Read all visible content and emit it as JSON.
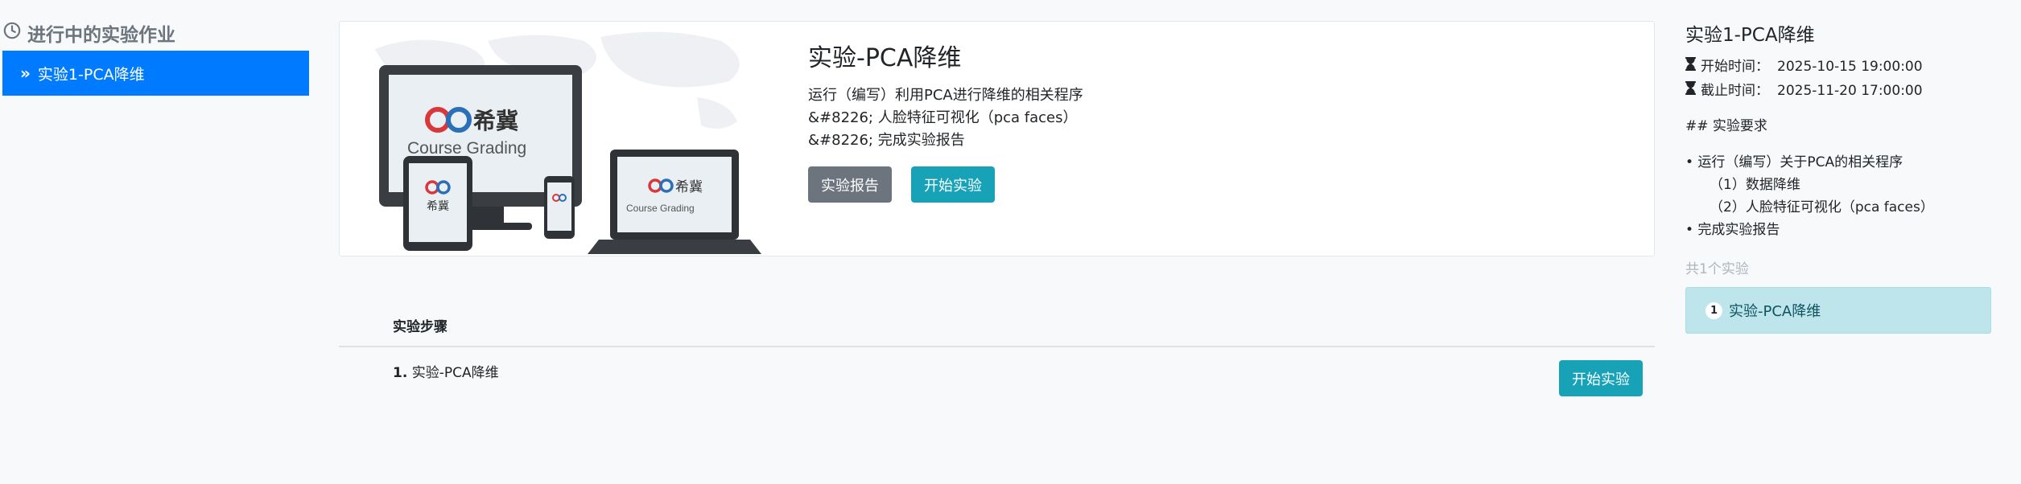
{
  "sidebar": {
    "title": "进行中的实验作业",
    "items": [
      {
        "label": "实验1-PCA降维"
      }
    ]
  },
  "card": {
    "logo_text": "希冀",
    "logo_sub": "Course Grading",
    "title": "实验-PCA降维",
    "description": [
      "运行（编写）利用PCA进行降维的相关程序",
      "&#8226; 人脸特征可视化（pca faces）",
      "&#8226; 完成实验报告"
    ],
    "buttons": {
      "report": "实验报告",
      "start": "开始实验"
    }
  },
  "steps": {
    "header": "实验步骤",
    "items": [
      {
        "index": "1.",
        "label": "实验-PCA降维",
        "button": "开始实验"
      }
    ]
  },
  "right_panel": {
    "title": "实验1-PCA降维",
    "start_label": "开始时间：",
    "start_value": "2025-10-15 19:00:00",
    "end_label": "截止时间：",
    "end_value": "2025-11-20 17:00:00",
    "req_heading": "## 实验要求",
    "requirements": [
      "• 运行（编写）关于PCA的相关程序",
      "（1）数据降维",
      "（2）人脸特征可视化（pca faces）",
      "• 完成实验报告"
    ],
    "count": "共1个实验",
    "experiments": [
      {
        "number": "1",
        "label": "实验-PCA降维"
      }
    ]
  },
  "colors": {
    "primary": "#007bff",
    "info": "#17a2b8",
    "secondary": "#6c757d",
    "light_info": "#bee5eb"
  }
}
